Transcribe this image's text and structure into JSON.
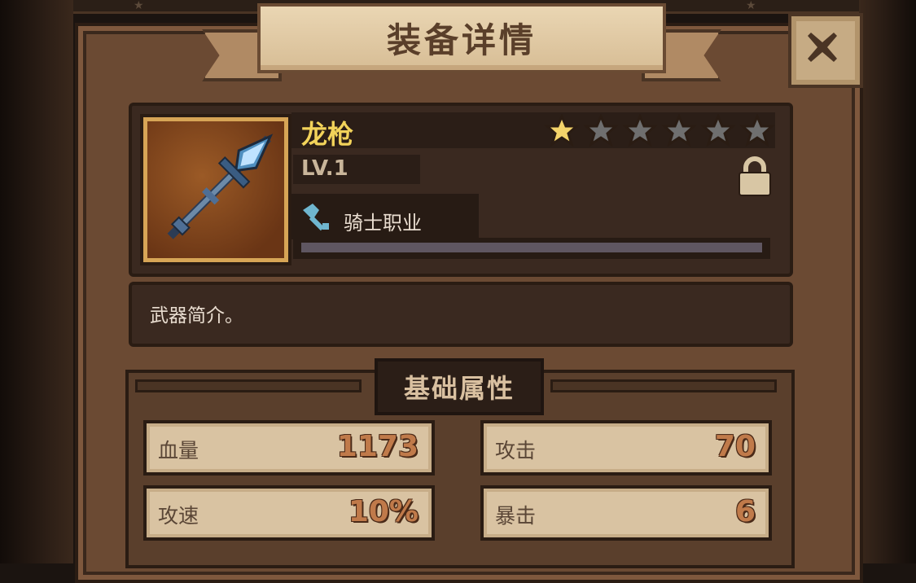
{
  "window": {
    "title": "装备详情",
    "close_icon": "close-x-icon"
  },
  "item": {
    "name": "龙枪",
    "level_label": "LV.1",
    "star_rating": 1,
    "star_max": 6,
    "locked": true,
    "class_label": "骑士职业",
    "class_icon": "axe-icon",
    "progress_fraction": 0,
    "description": "武器简介。",
    "icon": "dragon-spear-icon"
  },
  "attributes": {
    "title": "基础属性",
    "stats": [
      {
        "label": "血量",
        "value": "1173"
      },
      {
        "label": "攻击",
        "value": "70"
      },
      {
        "label": "攻速",
        "value": "10%"
      },
      {
        "label": "暴击",
        "value": "6"
      }
    ]
  },
  "colors": {
    "name_gold": "#f2d35a",
    "star_active": "#f4d46a",
    "star_inactive": "#6f6f6f",
    "stat_value": "#c07a4a"
  }
}
